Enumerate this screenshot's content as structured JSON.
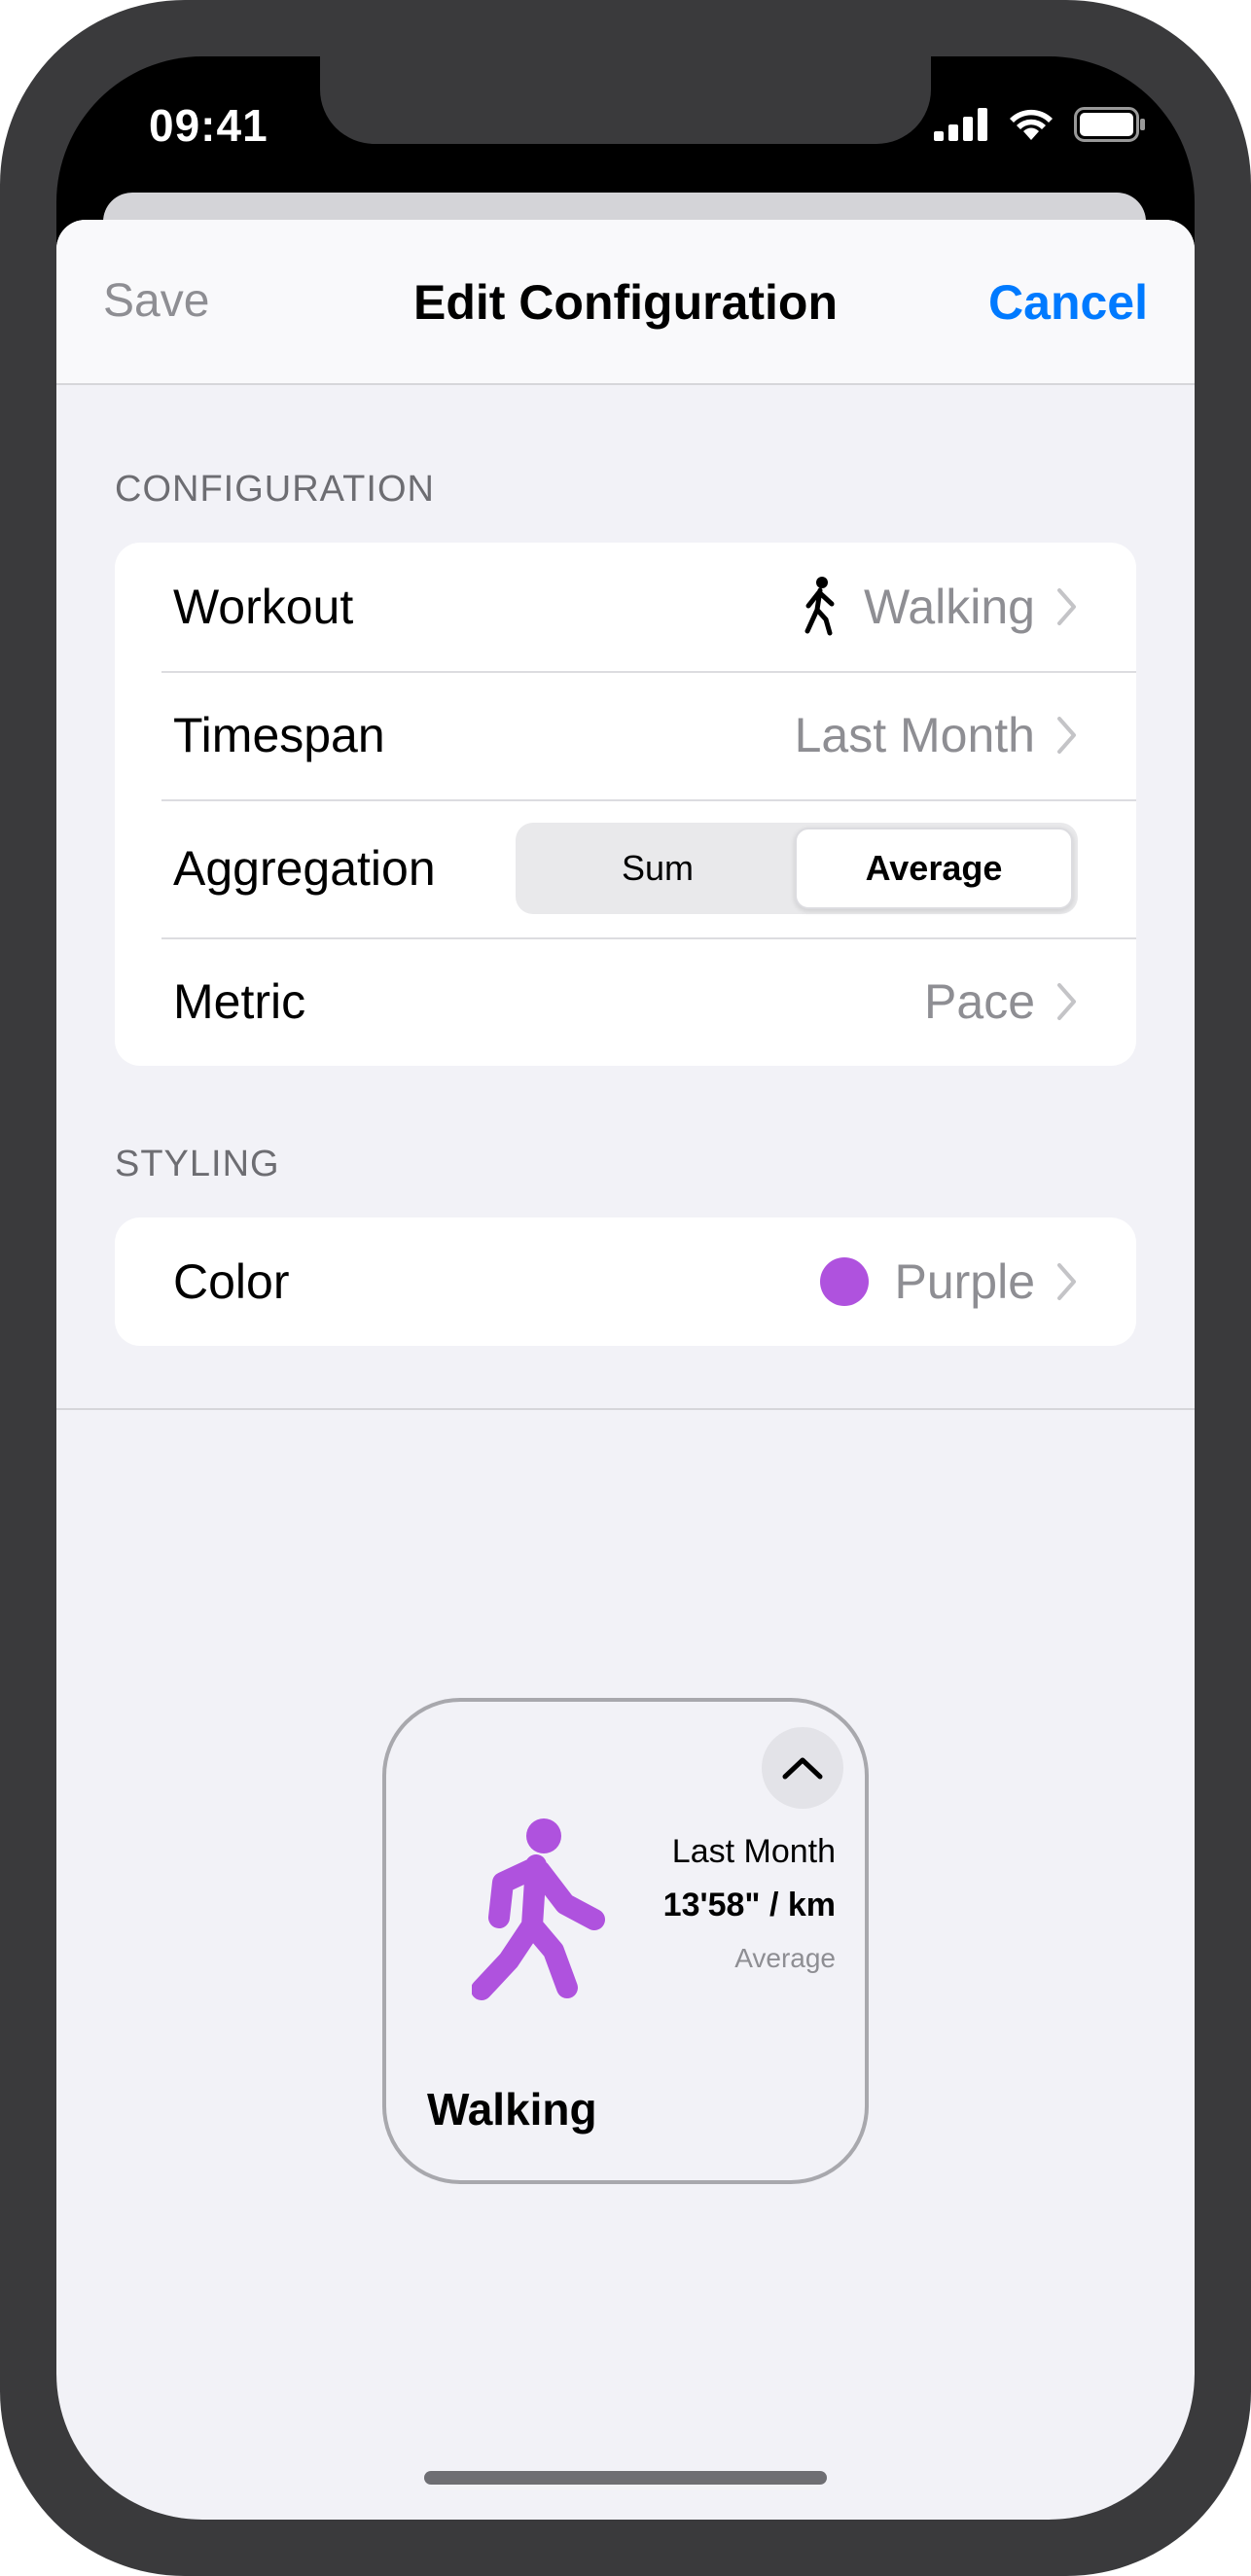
{
  "status_bar": {
    "time": "09:41"
  },
  "nav": {
    "save_label": "Save",
    "title": "Edit Configuration",
    "cancel_label": "Cancel"
  },
  "sections": {
    "configuration": {
      "header": "CONFIGURATION",
      "rows": {
        "workout": {
          "label": "Workout",
          "value": "Walking",
          "icon": "walking-figure-icon"
        },
        "timespan": {
          "label": "Timespan",
          "value": "Last Month"
        },
        "aggregation": {
          "label": "Aggregation",
          "options": [
            "Sum",
            "Average"
          ],
          "selected": "Average"
        },
        "metric": {
          "label": "Metric",
          "value": "Pace"
        }
      }
    },
    "styling": {
      "header": "STYLING",
      "rows": {
        "color": {
          "label": "Color",
          "value": "Purple",
          "swatch": "#af52de"
        }
      }
    }
  },
  "widget": {
    "timespan": "Last Month",
    "value": "13'58\" / km",
    "aggregation": "Average",
    "workout_name": "Walking",
    "accent_color": "#af52de"
  },
  "colors": {
    "accent": "#007aff",
    "secondary_text": "#8e8e93"
  }
}
